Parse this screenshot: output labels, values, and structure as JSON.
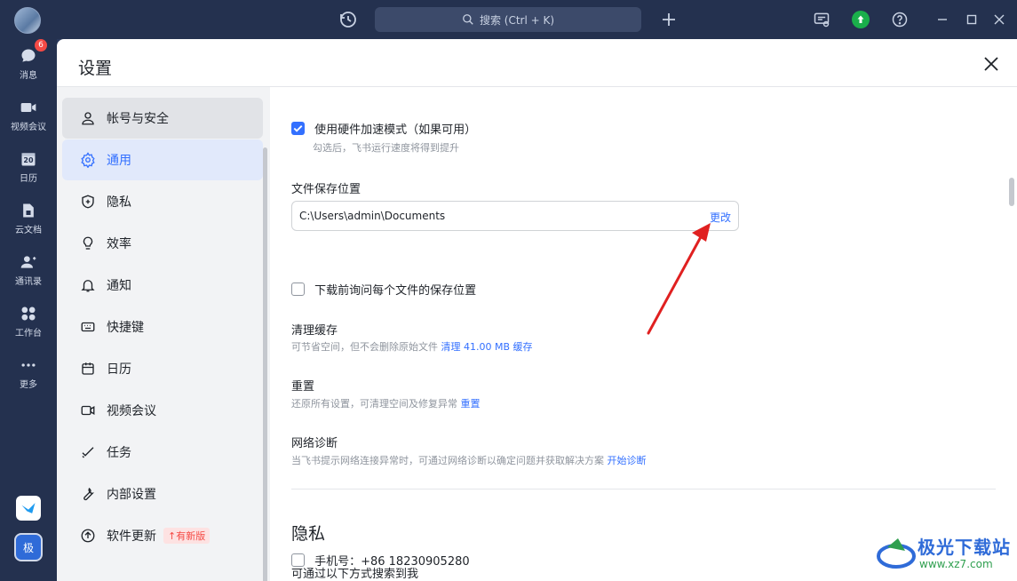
{
  "topbar": {
    "search_placeholder": "搜索 (Ctrl + K)"
  },
  "dock": {
    "items": [
      {
        "label": "消息",
        "icon": "chat-bubble-icon",
        "badge": "6"
      },
      {
        "label": "视频会议",
        "icon": "video-camera-icon"
      },
      {
        "label": "日历",
        "icon": "calendar-icon",
        "day": "20"
      },
      {
        "label": "云文档",
        "icon": "cloud-doc-icon"
      },
      {
        "label": "通讯录",
        "icon": "contacts-icon"
      },
      {
        "label": "工作台",
        "icon": "workspace-grid-icon"
      },
      {
        "label": "更多",
        "icon": "more-dots-icon"
      }
    ],
    "app2_label": "极"
  },
  "settings": {
    "title": "设置",
    "nav": [
      {
        "label": "帐号与安全",
        "icon": "user-icon",
        "state": "hover"
      },
      {
        "label": "通用",
        "icon": "gear-icon",
        "state": "active"
      },
      {
        "label": "隐私",
        "icon": "shield-icon"
      },
      {
        "label": "效率",
        "icon": "lightbulb-icon"
      },
      {
        "label": "通知",
        "icon": "bell-icon"
      },
      {
        "label": "快捷键",
        "icon": "keyboard-icon"
      },
      {
        "label": "日历",
        "icon": "calendar-icon"
      },
      {
        "label": "视频会议",
        "icon": "video-camera-icon"
      },
      {
        "label": "任务",
        "icon": "task-check-icon"
      },
      {
        "label": "内部设置",
        "icon": "wrench-icon"
      },
      {
        "label": "软件更新",
        "icon": "upload-circle-icon",
        "tag": "有新版"
      }
    ],
    "general": {
      "hw_accel_label": "使用硬件加速模式（如果可用）",
      "hw_accel_desc": "勾选后，飞书运行速度将得到提升",
      "hw_accel_checked": true,
      "save_location_label": "文件保存位置",
      "save_path": "C:\\Users\\admin\\Documents",
      "change_label": "更改",
      "ask_location_label": "下载前询问每个文件的保存位置",
      "ask_location_checked": false,
      "clear_cache_title": "清理缓存",
      "clear_cache_desc": "可节省空间，但不会删除原始文件",
      "clear_cache_link": "清理 41.00 MB 缓存",
      "reset_title": "重置",
      "reset_desc": "还原所有设置，可清理空间及修复异常",
      "reset_link": "重置",
      "net_title": "网络诊断",
      "net_desc": "当飞书提示网络连接异常时，可通过网络诊断以确定问题并获取解决方案",
      "net_link": "开始诊断"
    },
    "privacy": {
      "section_title": "隐私",
      "search_me_label": "可通过以下方式搜索到我",
      "phone_label": "手机号：+86 18230905280",
      "phone_checked": false
    }
  },
  "watermark": {
    "text": "极光下载站",
    "url": "www.xz7.com"
  },
  "colors": {
    "accent": "#3370ff",
    "sidebar_bg": "#24314f",
    "annotation_arrow": "#e02020"
  }
}
